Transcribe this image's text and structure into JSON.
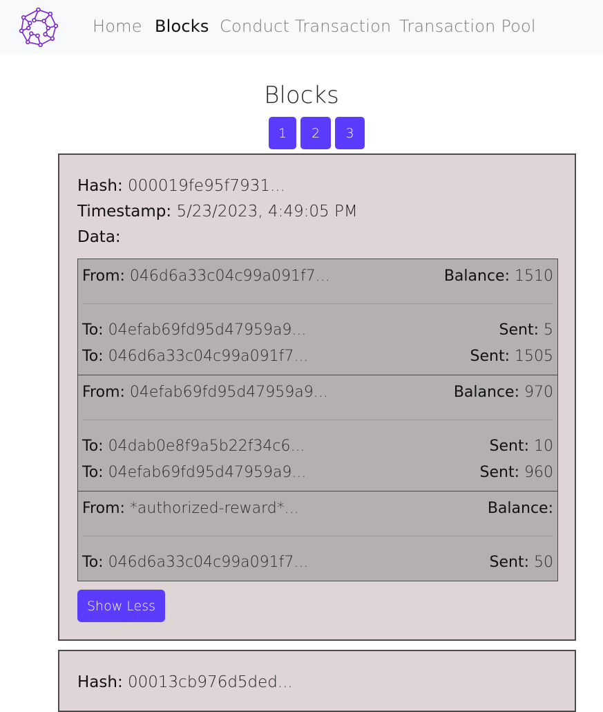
{
  "nav": {
    "logo_icon": "network-node-icon",
    "items": [
      {
        "label": "Home",
        "active": false
      },
      {
        "label": "Blocks",
        "active": true
      },
      {
        "label": "Conduct Transaction",
        "active": false
      },
      {
        "label": "Transaction Pool",
        "active": false
      }
    ]
  },
  "page": {
    "title": "Blocks",
    "pages": [
      "1",
      "2",
      "3"
    ]
  },
  "colors": {
    "accent": "#5b3cff",
    "card_bg": "#dfd4d6",
    "tx_bg": "#b5b0b0",
    "navbar_bg": "#f8f9fa"
  },
  "labels": {
    "hash": "Hash:",
    "timestamp": "Timestamp:",
    "data": "Data:",
    "from": "From:",
    "to": "To:",
    "balance": "Balance:",
    "sent": "Sent:"
  },
  "blocks": [
    {
      "hash": "000019fe95f7931...",
      "timestamp": "5/23/2023, 4:49:05 PM",
      "transactions": [
        {
          "from": "046d6a33c04c99a091f7...",
          "balance": "1510",
          "outputs": [
            {
              "to": "04efab69fd95d47959a9...",
              "sent": "5"
            },
            {
              "to": "046d6a33c04c99a091f7...",
              "sent": "1505"
            }
          ]
        },
        {
          "from": "04efab69fd95d47959a9...",
          "balance": "970",
          "outputs": [
            {
              "to": "04dab0e8f9a5b22f34c6...",
              "sent": "10"
            },
            {
              "to": "04efab69fd95d47959a9...",
              "sent": "960"
            }
          ]
        },
        {
          "from": "*authorized-reward*...",
          "balance": "",
          "outputs": [
            {
              "to": "046d6a33c04c99a091f7...",
              "sent": "50"
            }
          ]
        }
      ],
      "toggle_label": "Show Less"
    },
    {
      "hash": "00013cb976d5ded..."
    }
  ]
}
